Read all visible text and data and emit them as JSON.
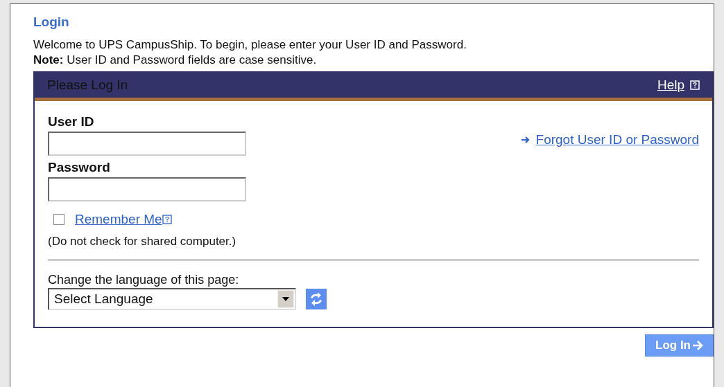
{
  "heading": "Login",
  "intro": "Welcome to UPS CampusShip. To begin, please enter your User ID and Password.",
  "note": "**Note:** User ID and Password fields are case sensitive.",
  "panel": {
    "title": "Please Log In",
    "help_link": "Help",
    "fields": [
      {
        "label": "User ID"
      },
      {
        "label": "Password"
      }
    ],
    "forgot_link": "Forgot User ID or Password",
    "remember": {
      "label": "Remember Me",
      "checked": false
    },
    "remember_hint": "(Do not check for shared computer.)",
    "language_label": "Change the language of this page:",
    "language_select": "Select Language"
  },
  "login_button": "Log In"
}
